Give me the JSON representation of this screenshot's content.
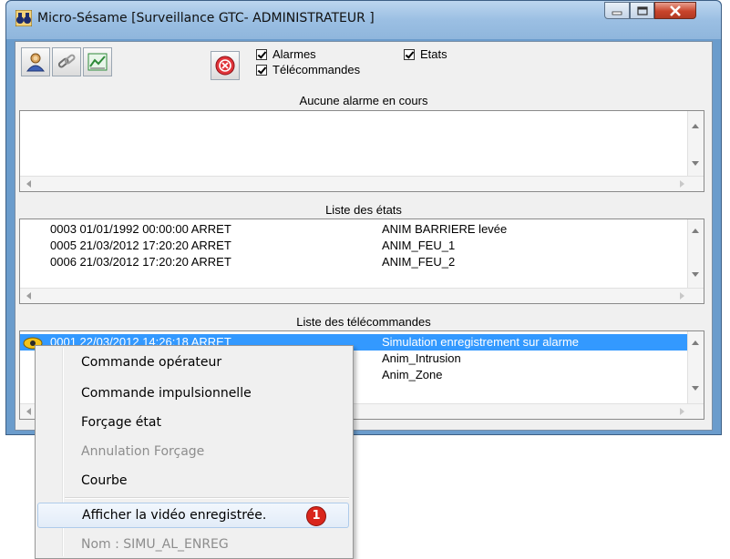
{
  "window": {
    "title": "Micro-Sésame [Surveillance GTC- ADMINISTRATEUR ]"
  },
  "toolbar": {
    "checkboxes": [
      {
        "label": "Alarmes",
        "checked": true
      },
      {
        "label": "Etats",
        "checked": true
      },
      {
        "label": "Télécommandes",
        "checked": true
      }
    ]
  },
  "alarms": {
    "header": "Aucune alarme en cours"
  },
  "states": {
    "header": "Liste des états",
    "rows": [
      {
        "info": "0003 01/01/1992 00:00:00 ARRET",
        "name": "ANIM BARRIERE levée"
      },
      {
        "info": "0005 21/03/2012 17:20:20 ARRET",
        "name": "ANIM_FEU_1"
      },
      {
        "info": "0006 21/03/2012 17:20:20 ARRET",
        "name": "ANIM_FEU_2"
      }
    ]
  },
  "commands": {
    "header": "Liste des télécommandes",
    "rows": [
      {
        "info": "0001 22/03/2012 14:26:18 ARRET",
        "name": "Simulation enregistrement sur alarme",
        "selected": true
      },
      {
        "info": "",
        "name": "Anim_Intrusion"
      },
      {
        "info": "",
        "name": "Anim_Zone"
      }
    ]
  },
  "context_menu": {
    "items": [
      {
        "label": "Commande opérateur",
        "enabled": true
      },
      {
        "label": "Commande impulsionnelle",
        "enabled": true
      },
      {
        "label": "Forçage état",
        "enabled": true
      },
      {
        "label": "Annulation Forçage",
        "enabled": false
      },
      {
        "label": "Courbe",
        "enabled": true
      },
      {
        "label": "Afficher la vidéo enregistrée.",
        "enabled": true,
        "highlighted": true
      },
      {
        "label": "Nom : SIMU_AL_ENREG",
        "enabled": false
      }
    ],
    "callout_number": "1"
  },
  "colors": {
    "selection": "#3399ff",
    "title_bar": "#9bbfe3",
    "close_button": "#c8442b",
    "callout": "#d9261c"
  }
}
